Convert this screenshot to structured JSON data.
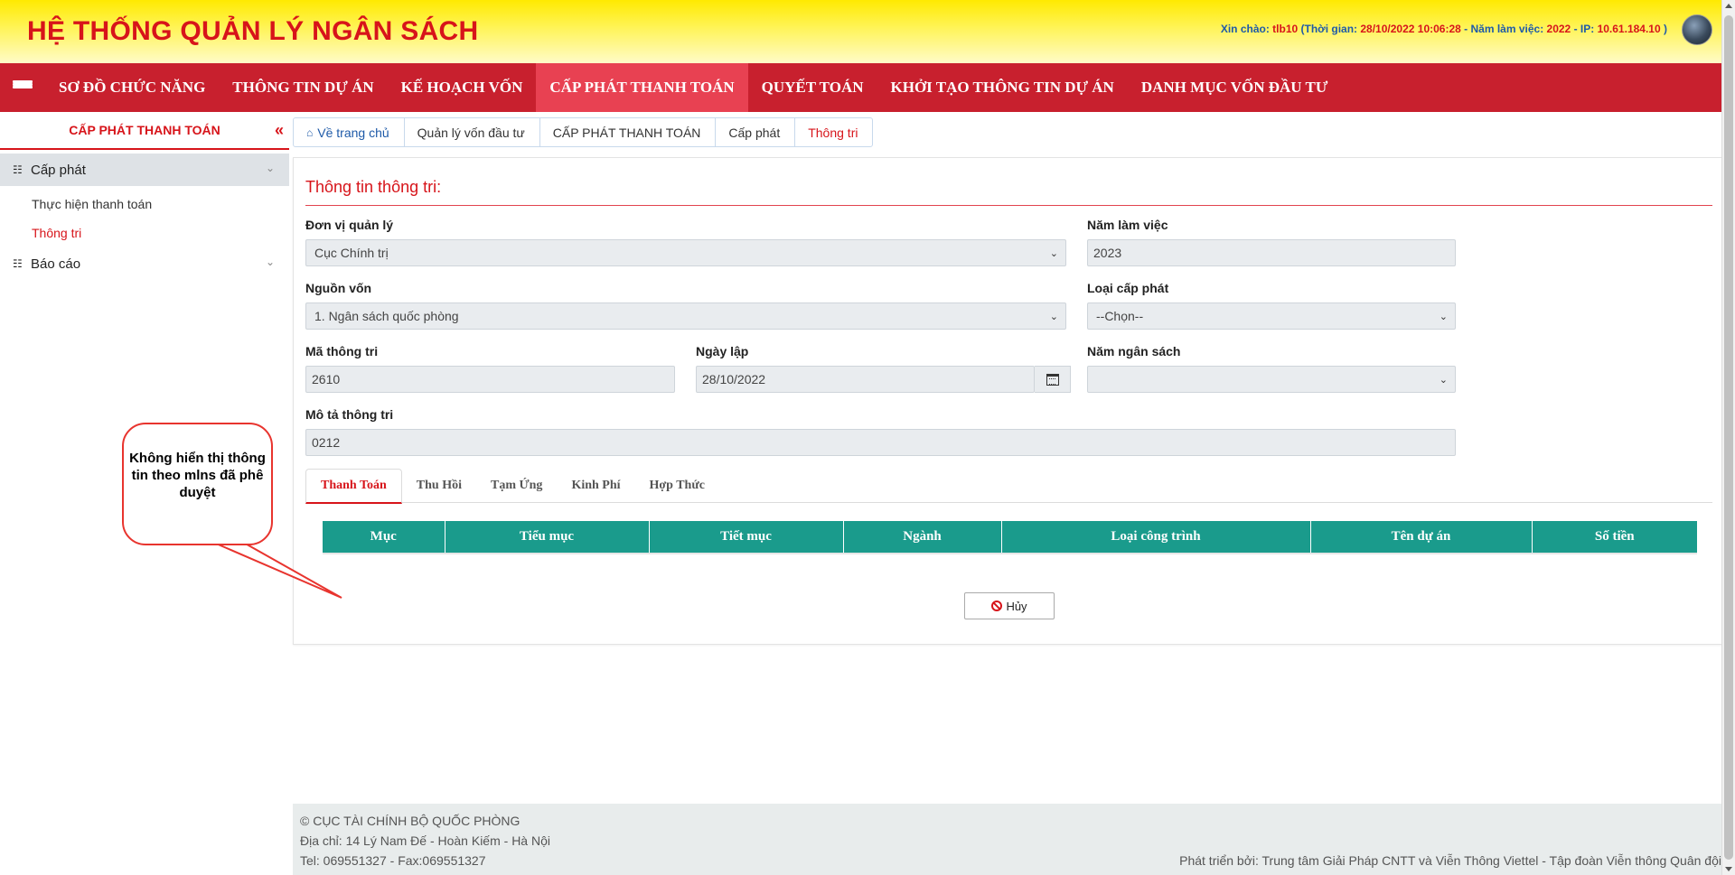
{
  "header": {
    "title": "HỆ THỐNG QUẢN LÝ NGÂN SÁCH",
    "greeting_label": "Xin chào: ",
    "user": "tlb10",
    "time_label": " (Thời gian: ",
    "time": "28/10/2022 10:06:28",
    "year_label": " - Năm làm việc: ",
    "year": "2022",
    "ip_label": " - IP: ",
    "ip": "10.61.184.10",
    "close": " )"
  },
  "nav": {
    "items": [
      "SƠ ĐỒ CHỨC NĂNG",
      "THÔNG TIN DỰ ÁN",
      "KẾ HOẠCH VỐN",
      "CẤP PHÁT THANH TOÁN",
      "QUYẾT TOÁN",
      "KHỞI TẠO THÔNG TIN DỰ ÁN",
      "DANH MỤC VỐN ĐẦU TƯ"
    ],
    "active_index": 3
  },
  "sidebar": {
    "title": "CẤP PHÁT THANH TOÁN",
    "collapse_glyph": "«",
    "groups": [
      {
        "label": "Cấp phát",
        "children": [
          "Thực hiện thanh toán",
          "Thông tri"
        ],
        "active_child": 1
      },
      {
        "label": "Báo cáo",
        "children": []
      }
    ]
  },
  "breadcrumb": [
    "Về trang chủ",
    "Quản lý vốn đầu tư",
    "CẤP PHÁT THANH TOÁN",
    "Cấp phát",
    "Thông tri"
  ],
  "form": {
    "title": "Thông tin thông tri:",
    "don_vi_quan_ly": {
      "label": "Đơn vị quản lý",
      "value": "Cục Chính trị"
    },
    "nam_lam_viec": {
      "label": "Năm làm việc",
      "value": "2023"
    },
    "nguon_von": {
      "label": "Nguồn vốn",
      "value": "1. Ngân sách quốc phòng"
    },
    "loai_cap_phat": {
      "label": "Loại cấp phát",
      "value": "--Chọn--"
    },
    "ma_thong_tri": {
      "label": "Mã thông tri",
      "value": "2610"
    },
    "ngay_lap": {
      "label": "Ngày lập",
      "value": "28/10/2022"
    },
    "nam_ngan_sach": {
      "label": "Năm ngân sách",
      "value": ""
    },
    "mo_ta": {
      "label": "Mô tả thông tri",
      "value": "0212"
    }
  },
  "tabs": [
    "Thanh Toán",
    "Thu Hồi",
    "Tạm Ứng",
    "Kinh Phí",
    "Hợp Thức"
  ],
  "active_tab": 0,
  "table": {
    "headers": [
      "Mục",
      "Tiểu mục",
      "Tiết mục",
      "Ngành",
      "Loại công trình",
      "Tên dự án",
      "Số tiền"
    ],
    "header_color": "#1a9b8c"
  },
  "cancel_label": "Hủy",
  "callout": {
    "text": "Không hiển thị thông tin theo mlns đã phê duyệt"
  },
  "footer": {
    "line1": "© CỤC TÀI CHÍNH BỘ QUỐC PHÒNG",
    "line2": "Địa chỉ: 14 Lý Nam Đế - Hoàn Kiếm - Hà Nội",
    "line3": "Tel: 069551327 - Fax:069551327",
    "credit": "Phát triển bởi: Trung tâm Giải Pháp CNTT và Viễn Thông Viettel - Tập đoàn Viễn thông Quân đội"
  },
  "colors": {
    "brand_red": "#d7141a",
    "nav_red": "#c8202e",
    "nav_active": "#e84152",
    "header_yellow": "#ffea00",
    "table_teal": "#1a9b8c"
  },
  "icons": [
    "menu-icon",
    "sitemap-icon",
    "chevron-down-icon",
    "home-icon",
    "calendar-icon",
    "ban-icon",
    "double-chevron-left-icon"
  ]
}
